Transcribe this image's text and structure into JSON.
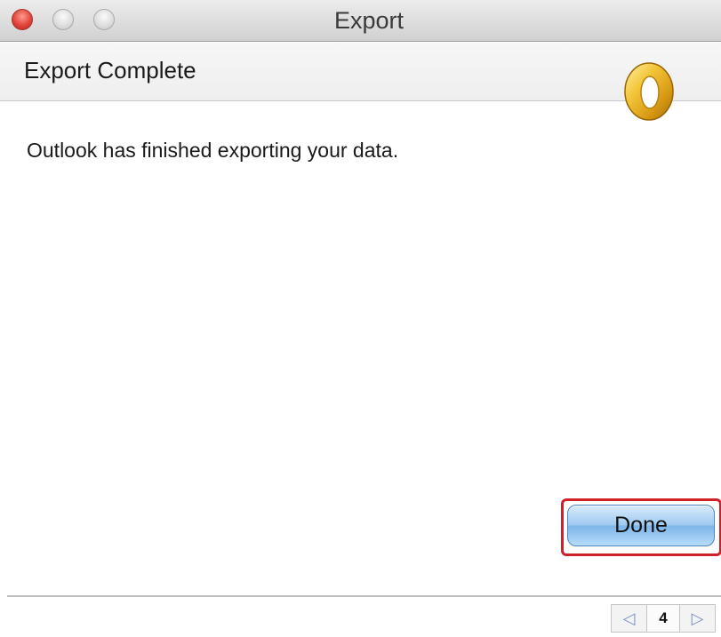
{
  "window": {
    "title": "Export",
    "buttons": [
      "close",
      "minimize",
      "zoom"
    ]
  },
  "header": {
    "title": "Export Complete",
    "logo_icon": "outlook-logo-icon"
  },
  "main": {
    "message": "Outlook has finished exporting your data."
  },
  "footer": {
    "done_label": "Done",
    "highlight_color": "#d0202a"
  },
  "pager": {
    "prev_icon": "triangle-left-icon",
    "page": "4",
    "next_icon": "triangle-right-icon"
  }
}
